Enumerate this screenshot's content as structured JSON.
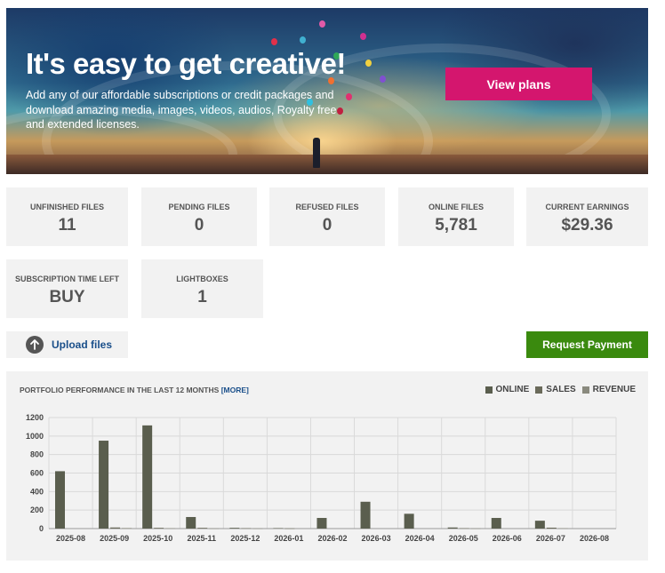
{
  "hero": {
    "title": "It's easy to get creative!",
    "subtitle": "Add any of our affordable subscriptions or credit packages and download amazing media, images, videos, audios, Royalty free and extended licenses.",
    "cta_label": "View plans",
    "cta_color": "#d4166e"
  },
  "stats": [
    {
      "label": "UNFINISHED FILES",
      "value": "11"
    },
    {
      "label": "PENDING FILES",
      "value": "0"
    },
    {
      "label": "REFUSED FILES",
      "value": "0"
    },
    {
      "label": "ONLINE FILES",
      "value": "5,781"
    },
    {
      "label": "CURRENT EARNINGS",
      "value": "$29.36"
    },
    {
      "label": "SUBSCRIPTION TIME LEFT",
      "value": "BUY"
    },
    {
      "label": "LIGHTBOXES",
      "value": "1"
    }
  ],
  "actions": {
    "upload_label": "Upload files",
    "upload_icon": "arrow-up-icon",
    "request_label": "Request Payment",
    "request_color": "#3a8a0e"
  },
  "chart_panel": {
    "title": "PORTFOLIO PERFORMANCE IN THE LAST 12 MONTHS",
    "more_label": "[MORE]"
  },
  "chart_data": {
    "type": "bar",
    "categories": [
      "2025-08",
      "2025-09",
      "2025-10",
      "2025-11",
      "2025-12",
      "2026-01",
      "2026-02",
      "2026-03",
      "2026-04",
      "2026-05",
      "2026-06",
      "2026-07",
      "2026-08"
    ],
    "series": [
      {
        "name": "ONLINE",
        "color": "#5a5e4e",
        "values": [
          620,
          950,
          1115,
          125,
          8,
          5,
          115,
          290,
          160,
          12,
          115,
          85,
          0
        ]
      },
      {
        "name": "SALES",
        "color": "#6a6a5a",
        "values": [
          0,
          12,
          8,
          8,
          4,
          2,
          0,
          0,
          0,
          4,
          0,
          10,
          0
        ]
      },
      {
        "name": "REVENUE",
        "color": "#8a8a7e",
        "values": [
          0,
          6,
          4,
          2,
          2,
          0,
          0,
          0,
          0,
          2,
          0,
          4,
          0
        ]
      }
    ],
    "ylim": [
      0,
      1200
    ],
    "yticks": [
      0,
      200,
      400,
      600,
      800,
      1000,
      1200
    ],
    "grid": true,
    "legend": "top-right"
  }
}
